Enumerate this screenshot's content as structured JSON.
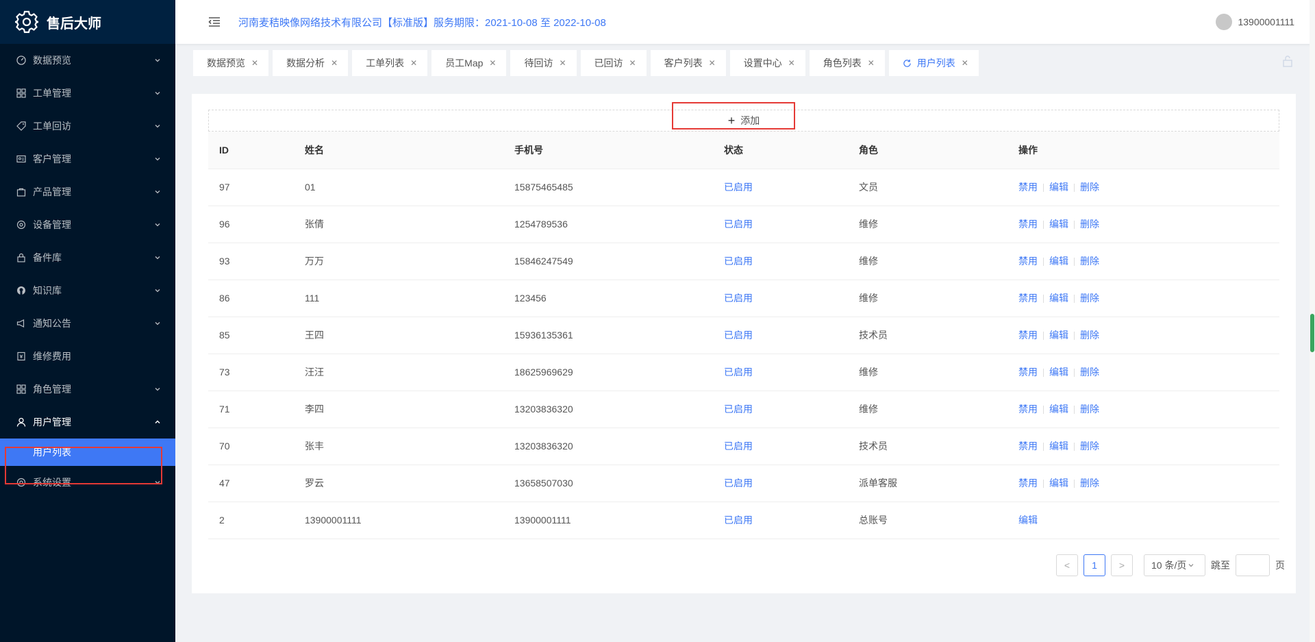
{
  "app": {
    "name": "售后大师"
  },
  "header": {
    "company": "河南麦秸映像网络技术有限公司【标准版】服务期限：2021-10-08 至 2022-10-08",
    "user": "13900001111"
  },
  "sidebar": {
    "items": [
      {
        "label": "数据预览"
      },
      {
        "label": "工单管理"
      },
      {
        "label": "工单回访"
      },
      {
        "label": "客户管理"
      },
      {
        "label": "产品管理"
      },
      {
        "label": "设备管理"
      },
      {
        "label": "备件库"
      },
      {
        "label": "知识库"
      },
      {
        "label": "通知公告"
      },
      {
        "label": "维修费用"
      },
      {
        "label": "角色管理"
      },
      {
        "label": "用户管理"
      },
      {
        "label": "系统设置"
      }
    ],
    "sub_item": "用户列表"
  },
  "tabs": [
    "数据预览",
    "数据分析",
    "工单列表",
    "员工Map",
    "待回访",
    "已回访",
    "客户列表",
    "设置中心",
    "角色列表",
    "用户列表"
  ],
  "add_label": "添加",
  "table": {
    "headers": [
      "ID",
      "姓名",
      "手机号",
      "状态",
      "角色",
      "操作"
    ],
    "rows": [
      {
        "id": "97",
        "name": "01",
        "phone": "15875465485",
        "status": "已启用",
        "role": "文员"
      },
      {
        "id": "96",
        "name": "张倩",
        "phone": "1254789536",
        "status": "已启用",
        "role": "维修"
      },
      {
        "id": "93",
        "name": "万万",
        "phone": "15846247549",
        "status": "已启用",
        "role": "维修"
      },
      {
        "id": "86",
        "name": "111",
        "phone": "123456",
        "status": "已启用",
        "role": "维修"
      },
      {
        "id": "85",
        "name": "王四",
        "phone": "15936135361",
        "status": "已启用",
        "role": "技术员"
      },
      {
        "id": "73",
        "name": "汪汪",
        "phone": "18625969629",
        "status": "已启用",
        "role": "维修"
      },
      {
        "id": "71",
        "name": "李四",
        "phone": "13203836320",
        "status": "已启用",
        "role": "维修"
      },
      {
        "id": "70",
        "name": "张丰",
        "phone": "13203836320",
        "status": "已启用",
        "role": "技术员"
      },
      {
        "id": "47",
        "name": "罗云",
        "phone": "13658507030",
        "status": "已启用",
        "role": "派单客服"
      },
      {
        "id": "2",
        "name": "13900001111",
        "phone": "13900001111",
        "status": "已启用",
        "role": "总账号"
      }
    ],
    "actions": {
      "disable": "禁用",
      "edit": "编辑",
      "delete": "删除"
    }
  },
  "pager": {
    "prev": "<",
    "next": ">",
    "current": "1",
    "size": "10 条/页",
    "jump": "跳至",
    "page_unit": "页"
  },
  "colors": {
    "accent": "#3e78f5",
    "sidebar": "#001529",
    "highlight_box": "#e53935"
  }
}
